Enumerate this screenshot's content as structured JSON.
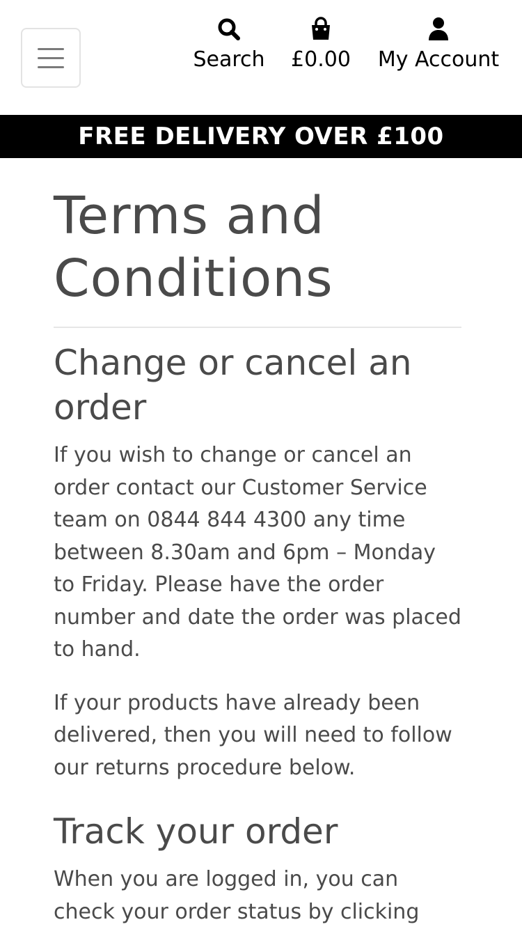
{
  "header": {
    "menu_icon": "hamburger-icon",
    "nav": {
      "search": {
        "label": "Search",
        "icon": "search-icon"
      },
      "cart": {
        "label": "£0.00",
        "icon": "shopping-bag-icon"
      },
      "account": {
        "label": "My Account",
        "icon": "user-icon"
      }
    }
  },
  "banner": {
    "text": "FREE DELIVERY OVER £100"
  },
  "main": {
    "title": "Terms and Conditions",
    "sections": [
      {
        "heading": "Change or cancel an order",
        "paragraphs": [
          "If you wish to change or cancel an order contact our Customer Service team on 0844 844 4300 any time between 8.30am and 6pm – Monday to Friday. Please have the order number and date the order was placed to hand.",
          "If your products have already been delivered, then you will need to follow our returns procedure below."
        ]
      },
      {
        "heading": "Track your order",
        "paragraphs": [
          "When you are logged in, you can check your order status by clicking"
        ]
      }
    ]
  },
  "colors": {
    "text": "#4a4a4a",
    "banner_bg": "#000000",
    "banner_text": "#ffffff",
    "nav_text": "#000000"
  }
}
